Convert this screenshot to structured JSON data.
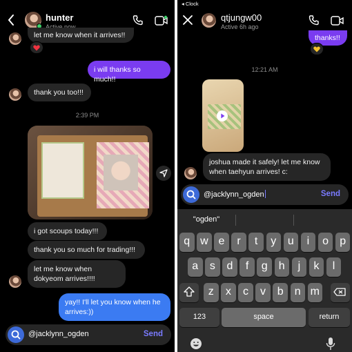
{
  "left": {
    "header": {
      "name": "hunter",
      "status": "Active now"
    },
    "messages": [
      {
        "text": "let me know when it arrives!!"
      },
      {
        "text": "i will thanks so much!!"
      },
      {
        "text": "thank you too!!!"
      },
      {
        "text": "i got scoups today!!!"
      },
      {
        "text": "thank you so much for trading!!!"
      },
      {
        "text": "let me know when dokyeom arrives!!!!"
      },
      {
        "text": "yay!! I'll let you know when he arrives:))"
      }
    ],
    "timestamp": "2:39 PM",
    "composer": {
      "value": "@jacklynn_ogden",
      "send_label": "Send"
    }
  },
  "right": {
    "status_bar": {
      "back_label": "◂ Clock"
    },
    "header": {
      "name": "qtjungw00",
      "status": "Active 6h ago"
    },
    "messages": [
      {
        "text": "thanks!!"
      },
      {
        "text": "joshua made it safely! let me know when taehyun arrives! c:"
      }
    ],
    "timestamp": "12:21 AM",
    "composer": {
      "value": "@jacklynn_ogden",
      "send_label": "Send"
    },
    "suggestion": "\"ogden\"",
    "keyboard": {
      "row1": [
        "q",
        "w",
        "e",
        "r",
        "t",
        "y",
        "u",
        "i",
        "o",
        "p"
      ],
      "row2": [
        "a",
        "s",
        "d",
        "f",
        "g",
        "h",
        "j",
        "k",
        "l"
      ],
      "row3": [
        "z",
        "x",
        "c",
        "v",
        "b",
        "n",
        "m"
      ],
      "numbers_label": "123",
      "space_label": "space",
      "return_label": "return"
    }
  },
  "colors": {
    "outgoing": "#7a3cf0",
    "outgoing_alt": "#3b7bf2",
    "incoming": "#262626",
    "accent": "#3d6ad8",
    "send": "#7a7bff"
  }
}
